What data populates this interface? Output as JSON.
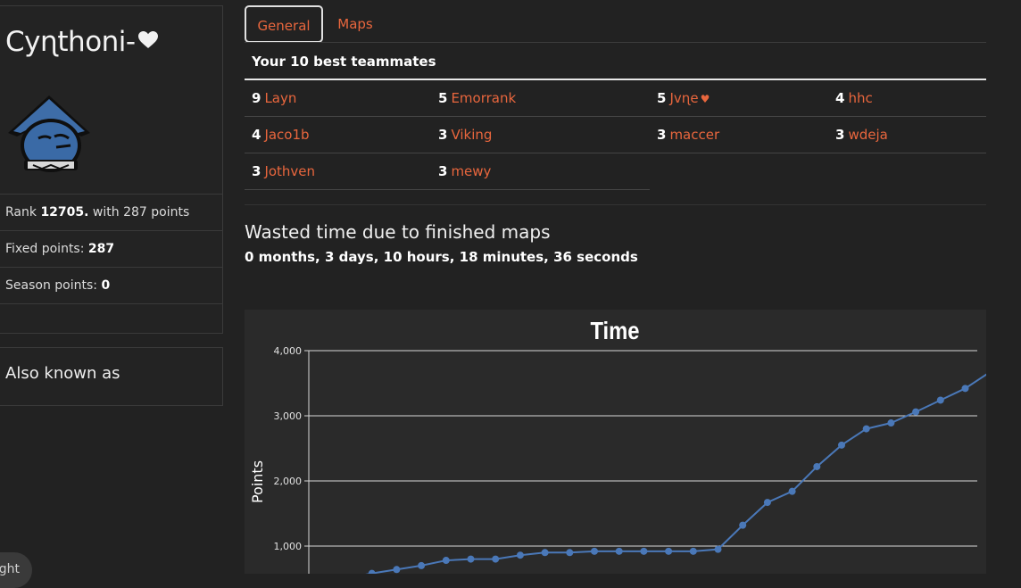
{
  "profile": {
    "name": "Cyɳthoni-",
    "heart_icon": "heart-icon",
    "avatar_icon": "straw-hat-character-avatar",
    "rank_prefix": "Rank",
    "rank_value": "12705.",
    "rank_suffix": "with 287 points",
    "fixed_label": "Fixed points:",
    "fixed_value": "287",
    "season_label": "Season points:",
    "season_value": "0"
  },
  "aka": {
    "title": "Also known as"
  },
  "bottom_pill": {
    "text": "ght"
  },
  "tabs": [
    {
      "label": "General",
      "active": true
    },
    {
      "label": "Maps",
      "active": false
    }
  ],
  "teammates": {
    "title": "Your 10 best teammates",
    "rows": [
      [
        {
          "count": "9",
          "name": "Layn"
        },
        {
          "count": "5",
          "name": "Emorrank"
        },
        {
          "count": "5",
          "name": "Jvɳe",
          "heart": "♥"
        },
        {
          "count": "4",
          "name": "hhc"
        }
      ],
      [
        {
          "count": "4",
          "name": "Jaco1b"
        },
        {
          "count": "3",
          "name": "Viking"
        },
        {
          "count": "3",
          "name": "maccer"
        },
        {
          "count": "3",
          "name": "wdeja"
        }
      ],
      [
        {
          "count": "3",
          "name": "Jothven"
        },
        {
          "count": "3",
          "name": "mewy"
        }
      ]
    ]
  },
  "wasted": {
    "title": "Wasted time due to finished maps",
    "value": "0 months, 3 days, 10 hours, 18 minutes, 36 seconds"
  },
  "colors": {
    "accent": "#e8663d",
    "line": "#4a78b8",
    "background": "#222222"
  },
  "chart_data": {
    "type": "line",
    "title": "Time",
    "ylabel": "Points",
    "xlabel": "",
    "yticks": [
      "1,000",
      "2,000",
      "3,000",
      "4,000"
    ],
    "ylim": [
      0,
      4000
    ],
    "grid": true,
    "series": [
      {
        "values": [
          510,
          580,
          640,
          700,
          780,
          800,
          800,
          860,
          900,
          900,
          920,
          920,
          920,
          920,
          920,
          950,
          1320,
          1670,
          1840,
          2220,
          2550,
          2800,
          2890,
          3060,
          3240,
          3420,
          3670
        ]
      }
    ]
  }
}
